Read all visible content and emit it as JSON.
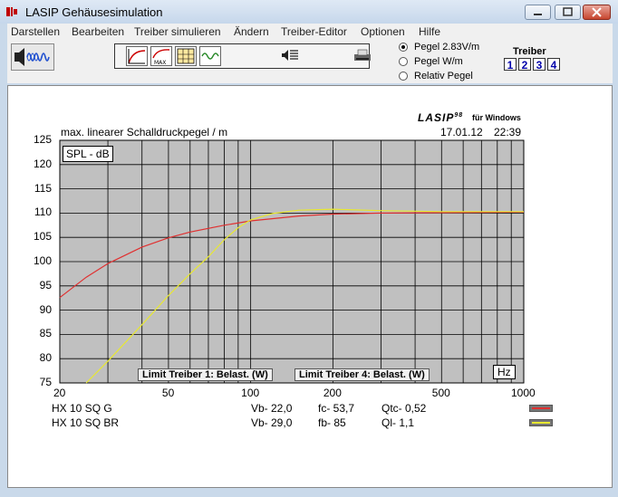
{
  "window": {
    "title": "LASIP  Gehäusesimulation"
  },
  "menu": [
    "Darstellen",
    "Bearbeiten",
    "Treiber simulieren",
    "Ändern",
    "Treiber-Editor",
    "Optionen",
    "Hilfe"
  ],
  "toolbar": {
    "pegel_options": [
      {
        "label": "Pegel 2.83V/m",
        "selected": true
      },
      {
        "label": "Pegel W/m",
        "selected": false
      },
      {
        "label": "Relativ Pegel",
        "selected": false
      }
    ],
    "treiber_label": "Treiber",
    "treiber_numbers": [
      "1",
      "2",
      "3",
      "4"
    ]
  },
  "header": {
    "logo": "LASIP",
    "logo_super": "98",
    "logo_suffix": "für Windows",
    "date": "17.01.12",
    "time": "22:39"
  },
  "chart_data": {
    "type": "line",
    "title": "max. linearer Schalldruckpegel  / m",
    "ylabel": "SPL - dB",
    "xlabel": "Hz",
    "x_scale": "log",
    "xlim": [
      20,
      1000
    ],
    "ylim": [
      75,
      125
    ],
    "yticks": [
      "125",
      "120",
      "115",
      "110",
      "105",
      "100",
      "95",
      "90",
      "85",
      "80",
      "75"
    ],
    "xticks": [
      "20",
      "50",
      "100",
      "200",
      "500",
      "1000"
    ],
    "limit_labels": [
      "Limit Treiber 1: Belast. (W)",
      "Limit Treiber 4: Belast. (W)"
    ],
    "grid": true,
    "series": [
      {
        "name": "HX 10 SQ G",
        "color": "#e03030",
        "x": [
          20,
          25,
          30,
          40,
          50,
          60,
          80,
          100,
          150,
          200,
          300,
          500,
          1000
        ],
        "y": [
          92.6,
          96.8,
          99.6,
          103.0,
          104.9,
          106.1,
          107.5,
          108.4,
          109.4,
          109.8,
          110.0,
          110.1,
          110.2
        ]
      },
      {
        "name": "HX 10 SQ BR",
        "color": "#e8e830",
        "x": [
          25,
          30,
          40,
          50,
          60,
          70,
          80,
          90,
          100,
          120,
          150,
          200,
          300,
          500,
          1000
        ],
        "y": [
          75.0,
          79.5,
          87.0,
          93.0,
          97.5,
          101.0,
          104.5,
          107.0,
          108.6,
          109.9,
          110.6,
          110.8,
          110.5,
          110.3,
          110.3
        ]
      }
    ]
  },
  "legend": [
    {
      "name": "HX 10 SQ G",
      "vb": "Vb- 22,0",
      "f": "fc- 53,7",
      "q": "Qtc- 0,52",
      "color": "#e03030"
    },
    {
      "name": "HX 10 SQ BR",
      "vb": "Vb- 29,0",
      "f": "fb- 85",
      "q": "Ql- 1,1",
      "color": "#e8e830"
    }
  ]
}
